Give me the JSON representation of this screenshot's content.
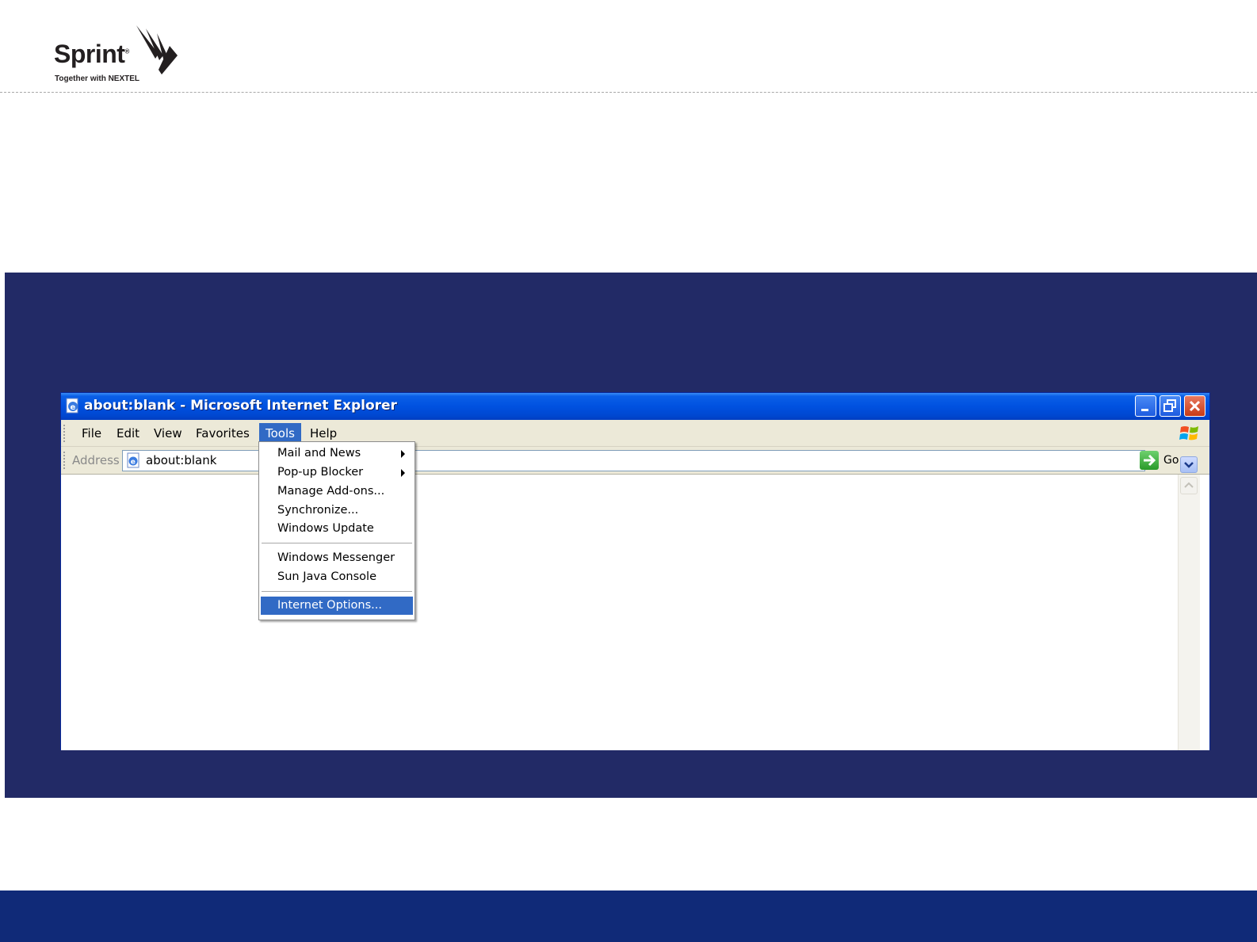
{
  "header": {
    "logo_wordmark": "Sprint",
    "logo_tagline": "Together with NEXTEL"
  },
  "window": {
    "title": "about:blank - Microsoft Internet Explorer",
    "title_bar_color": "#0051e0"
  },
  "menu_bar": {
    "items": [
      {
        "label": "File"
      },
      {
        "label": "Edit"
      },
      {
        "label": "View"
      },
      {
        "label": "Favorites"
      },
      {
        "label": "Tools",
        "active": true
      },
      {
        "label": "Help"
      }
    ]
  },
  "address_bar": {
    "label": "Address",
    "value": "about:blank",
    "go_label": "Go"
  },
  "tools_menu": {
    "items": [
      {
        "label": "Mail and News",
        "submenu": true
      },
      {
        "label": "Pop-up Blocker",
        "submenu": true
      },
      {
        "label": "Manage Add-ons..."
      },
      {
        "label": "Synchronize..."
      },
      {
        "label": "Windows Update"
      },
      {
        "label": "Windows Messenger"
      },
      {
        "label": "Sun Java Console"
      },
      {
        "label": "Internet Options...",
        "selected": true
      }
    ]
  },
  "colors": {
    "slide_panel": "#222a66",
    "footer_band": "#102a78",
    "menu_highlight": "#316ac5"
  },
  "icons": [
    "ie-app-icon",
    "minimize-icon",
    "restore-icon",
    "close-icon",
    "windows-logo-icon",
    "page-icon",
    "dropdown-arrow-icon",
    "go-arrow-icon",
    "scroll-up-icon",
    "submenu-arrow-icon"
  ]
}
